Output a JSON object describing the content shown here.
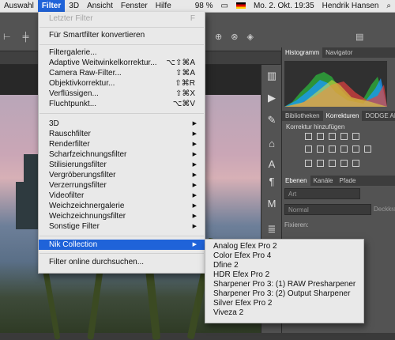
{
  "menubar": {
    "items": [
      "Auswahl",
      "Filter",
      "3D",
      "Ansicht",
      "Fenster",
      "Hilfe"
    ],
    "status": {
      "battery": "98 %",
      "datetime": "Mo. 2. Okt.  19:35",
      "user": "Hendrik Hansen"
    }
  },
  "filter_menu": {
    "last_filter": {
      "label": "Letzter Filter",
      "shortcut": "F"
    },
    "smart": "Für Smartfilter konvertieren",
    "items_a": [
      {
        "label": "Filtergalerie...",
        "shortcut": ""
      },
      {
        "label": "Adaptive Weitwinkelkorrektur...",
        "shortcut": "⌥⇧⌘A"
      },
      {
        "label": "Camera Raw-Filter...",
        "shortcut": "⇧⌘A"
      },
      {
        "label": "Objektivkorrektur...",
        "shortcut": "⇧⌘R"
      },
      {
        "label": "Verflüssigen...",
        "shortcut": "⇧⌘X"
      },
      {
        "label": "Fluchtpunkt...",
        "shortcut": "⌥⌘V"
      }
    ],
    "submenus": [
      "3D",
      "Rauschfilter",
      "Renderfilter",
      "Scharfzeichnungsfilter",
      "Stilisierungsfilter",
      "Vergröberungsfilter",
      "Verzerrungsfilter",
      "Videofilter",
      "Weichzeichnergalerie",
      "Weichzeichnungsfilter",
      "Sonstige Filter"
    ],
    "nik": "Nik Collection",
    "online": "Filter online durchsuchen..."
  },
  "nik_submenu": [
    "Analog Efex Pro 2",
    "Color Efex Pro 4",
    "Dfine 2",
    "HDR Efex Pro 2",
    "Sharpener Pro 3: (1) RAW Presharpener",
    "Sharpener Pro 3: (2) Output Sharpener",
    "Silver Efex Pro 2",
    "Viveza 2"
  ],
  "panels": {
    "histogram_tabs": [
      "Histogramm",
      "Navigator"
    ],
    "adjust_tabs": [
      "Bibliotheken",
      "Korrekturen",
      "DODGE AND"
    ],
    "adjust_title": "Korrektur hinzufügen",
    "layer_tabs": [
      "Ebenen",
      "Kanäle",
      "Pfade"
    ],
    "layer_search": "Art",
    "layer_mode": "Normal",
    "layer_opacity": "Deckkra",
    "fixieren": "Fixieren:"
  },
  "colors": {
    "highlight": "#1f63d9",
    "menu_bg": "#e9e9e9",
    "ps_panel": "#535353"
  }
}
